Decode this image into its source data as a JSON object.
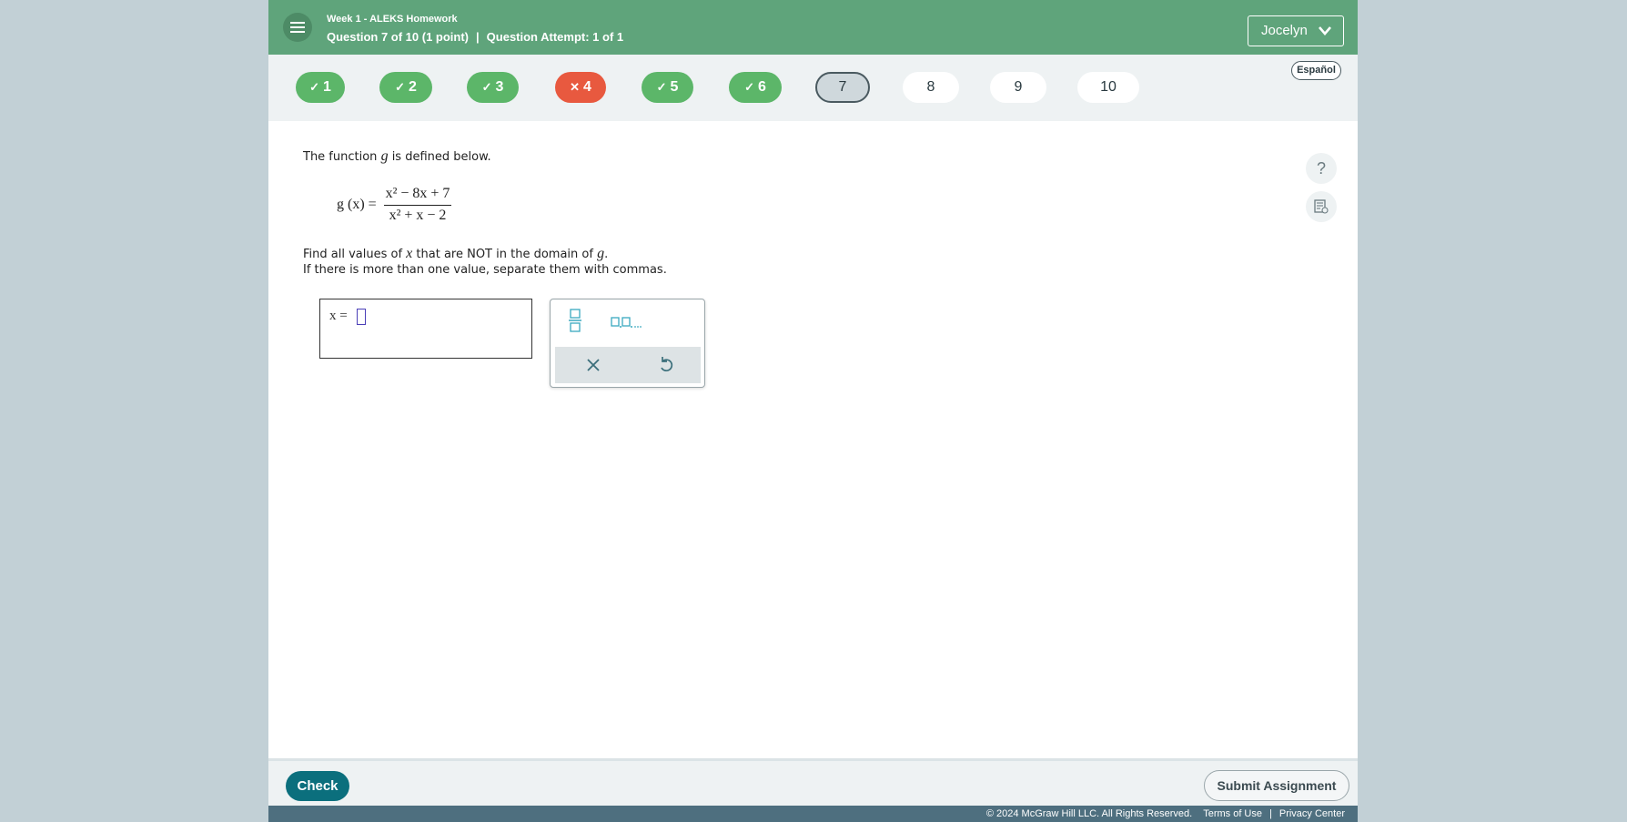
{
  "header": {
    "course_title": "Week 1 - ALEKS Homework",
    "question_label": "Question 7 of 10 (1 point)",
    "separator": "|",
    "attempt_label": "Question Attempt: 1 of 1",
    "user_name": "Jocelyn"
  },
  "nav": {
    "questions": [
      {
        "label": "1",
        "status": "correct"
      },
      {
        "label": "2",
        "status": "correct"
      },
      {
        "label": "3",
        "status": "correct"
      },
      {
        "label": "4",
        "status": "incorrect"
      },
      {
        "label": "5",
        "status": "correct"
      },
      {
        "label": "6",
        "status": "correct"
      },
      {
        "label": "7",
        "status": "current"
      },
      {
        "label": "8",
        "status": "unanswered"
      },
      {
        "label": "9",
        "status": "unanswered"
      },
      {
        "label": "10",
        "status": "unanswered"
      }
    ],
    "language_label": "Español"
  },
  "problem": {
    "intro_pre": "The function ",
    "function_name": "g",
    "intro_post": " is defined below.",
    "formula": {
      "lhs": "g (x) =",
      "numerator": "x² − 8x + 7",
      "denominator": "x² + x − 2"
    },
    "prompt_pre": "Find all values of ",
    "prompt_var": "x",
    "prompt_mid": " that are NOT in the domain of ",
    "prompt_fn": "g",
    "prompt_end": ".",
    "prompt_line2": "If there is more than one value, separate them with commas."
  },
  "answer": {
    "prefix": "x =",
    "value": ""
  },
  "keypad": {
    "buttons": [
      "fraction-icon",
      "list-separator-icon",
      "clear-icon",
      "undo-icon"
    ]
  },
  "side_tools": {
    "help_label": "?"
  },
  "footer": {
    "check_label": "Check",
    "submit_label": "Submit Assignment",
    "copyright": "© 2024 McGraw Hill LLC. All Rights Reserved.",
    "terms_label": "Terms of Use",
    "separator": "|",
    "privacy_label": "Privacy Center"
  },
  "colors": {
    "header": "#5fa47b",
    "correct": "#5cb669",
    "incorrect": "#e8593f",
    "check_button": "#0b6f7d",
    "copyright_bar": "#4e6f7f"
  }
}
